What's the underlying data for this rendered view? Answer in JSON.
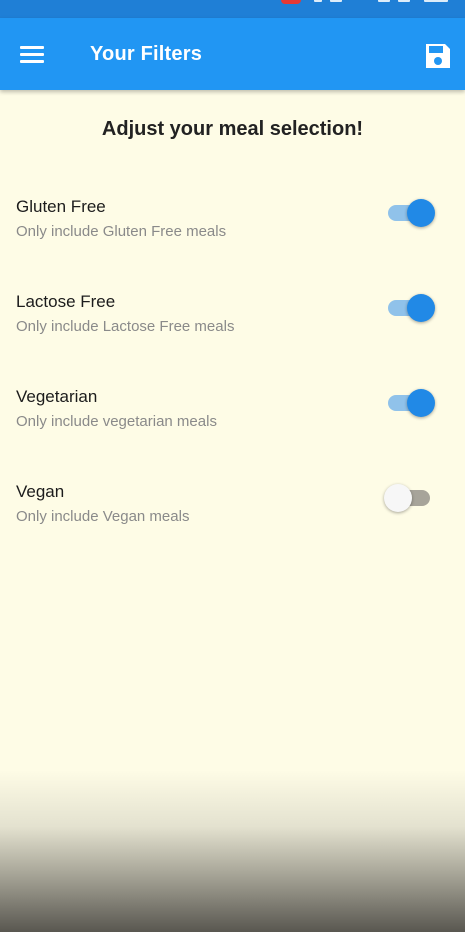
{
  "colors": {
    "app_bar": "#2196F3",
    "status_bar": "#1F7FD6",
    "background": "#FEFCE6",
    "switch_on_thumb": "#2189E6",
    "switch_on_track": "#90C2EA",
    "switch_off_thumb": "#F7F7F7",
    "switch_off_track": "#A7A49A"
  },
  "app_bar": {
    "title": "Your Filters",
    "menu_icon": "hamburger-menu-icon",
    "save_icon": "floppy-disk-save-icon"
  },
  "main": {
    "heading": "Adjust your meal selection!",
    "filters": [
      {
        "title": "Gluten Free",
        "subtitle": "Only include Gluten Free meals",
        "enabled": true
      },
      {
        "title": "Lactose Free",
        "subtitle": "Only include Lactose Free meals",
        "enabled": true
      },
      {
        "title": "Vegetarian",
        "subtitle": "Only include vegetarian meals",
        "enabled": true
      },
      {
        "title": "Vegan",
        "subtitle": "Only include Vegan meals",
        "enabled": false
      }
    ]
  }
}
